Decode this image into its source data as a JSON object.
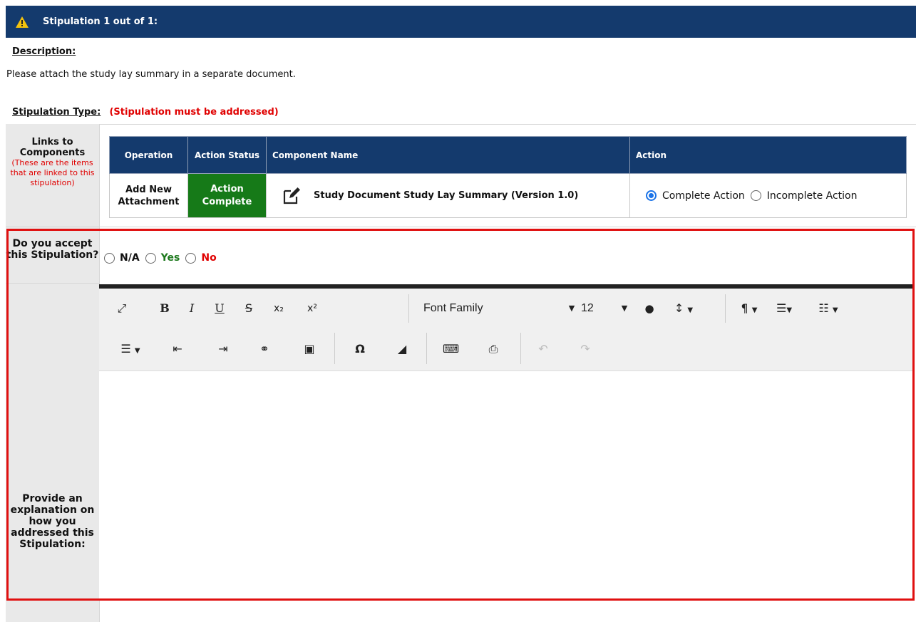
{
  "header": {
    "title": "Stipulation 1 out of 1:"
  },
  "description": {
    "label": "Description:",
    "text": "Please attach the study lay summary in a separate document."
  },
  "stipulation_type": {
    "label": "Stipulation Type:",
    "requirement": "(Stipulation must be addressed)"
  },
  "links": {
    "label": "Links to Components",
    "note": "(These are the items that are linked to this stipulation)",
    "columns": [
      "Operation",
      "Action Status",
      "Component Name",
      "Action"
    ],
    "row": {
      "operation": "Add New Attachment",
      "status": "Action Complete",
      "component_name": "Study Document Study Lay Summary  (Version 1.0)",
      "action_options": [
        "Complete Action",
        "Incomplete Action"
      ],
      "action_selected": "Complete Action"
    }
  },
  "accept": {
    "label": "Do you accept this Stipulation?",
    "options": [
      "N/A",
      "Yes",
      "No"
    ]
  },
  "editor": {
    "font_family": "Font Family",
    "font_size": "12"
  },
  "explain": {
    "label": "Provide an explanation on how you addressed this Stipulation:"
  },
  "colors": {
    "header_bg": "#143a6d",
    "status_bg": "#167a18",
    "required": "#e00000",
    "highlight_border": "#e01010",
    "yes": "#1f7a1f",
    "no": "#e00000"
  }
}
